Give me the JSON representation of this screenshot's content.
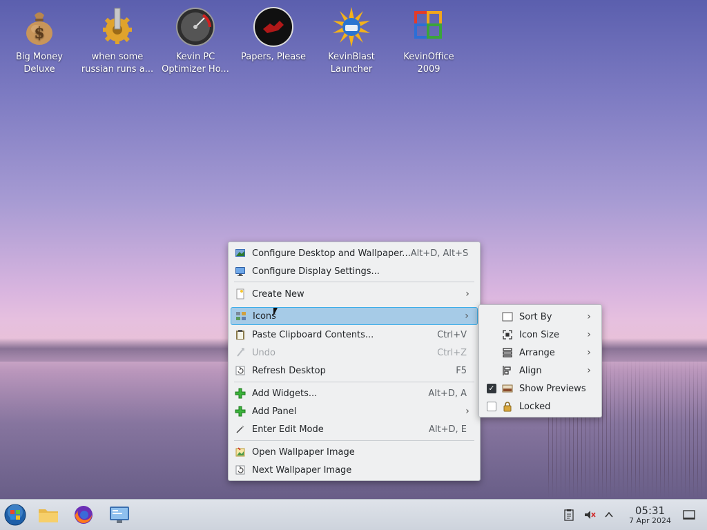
{
  "desktop": {
    "icons": [
      {
        "line1": "Big Money",
        "line2": "Deluxe",
        "icon": "money-bag-icon"
      },
      {
        "line1": "when some",
        "line2": "russian runs a...",
        "icon": "gear-icon"
      },
      {
        "line1": "Kevin PC",
        "line2": "Optimizer Ho...",
        "icon": "gauge-icon"
      },
      {
        "line1": "Papers, Please",
        "line2": "",
        "icon": "papers-please-icon"
      },
      {
        "line1": "KevinBlast",
        "line2": "Launcher",
        "icon": "sun-disc-icon"
      },
      {
        "line1": "KevinOffice",
        "line2": "2009",
        "icon": "office-logo-icon"
      }
    ]
  },
  "context_menu": {
    "items": [
      {
        "label": "Configure Desktop and Wallpaper...",
        "shortcut": "Alt+D, Alt+S"
      },
      {
        "label": "Configure Display Settings...",
        "shortcut": ""
      },
      {
        "label": "Create New",
        "shortcut": ""
      },
      {
        "label": "Icons",
        "shortcut": ""
      },
      {
        "label": "Paste Clipboard Contents...",
        "shortcut": "Ctrl+V"
      },
      {
        "label": "Undo",
        "shortcut": "Ctrl+Z"
      },
      {
        "label": "Refresh Desktop",
        "shortcut": "F5"
      },
      {
        "label": "Add Widgets...",
        "shortcut": "Alt+D, A"
      },
      {
        "label": "Add Panel",
        "shortcut": ""
      },
      {
        "label": "Enter Edit Mode",
        "shortcut": "Alt+D, E"
      },
      {
        "label": "Open Wallpaper Image",
        "shortcut": ""
      },
      {
        "label": "Next Wallpaper Image",
        "shortcut": ""
      }
    ]
  },
  "icons_submenu": {
    "items": [
      {
        "label": "Sort By"
      },
      {
        "label": "Icon Size"
      },
      {
        "label": "Arrange"
      },
      {
        "label": "Align"
      },
      {
        "label": "Show Previews",
        "checked": true
      },
      {
        "label": "Locked",
        "checked": false
      }
    ]
  },
  "taskbar": {
    "time": "05:31",
    "date": "7 Apr 2024"
  },
  "colors": {
    "highlight": "#a6cbe7",
    "highlight_border": "#3daee9",
    "menu_bg": "#eff0f1"
  }
}
